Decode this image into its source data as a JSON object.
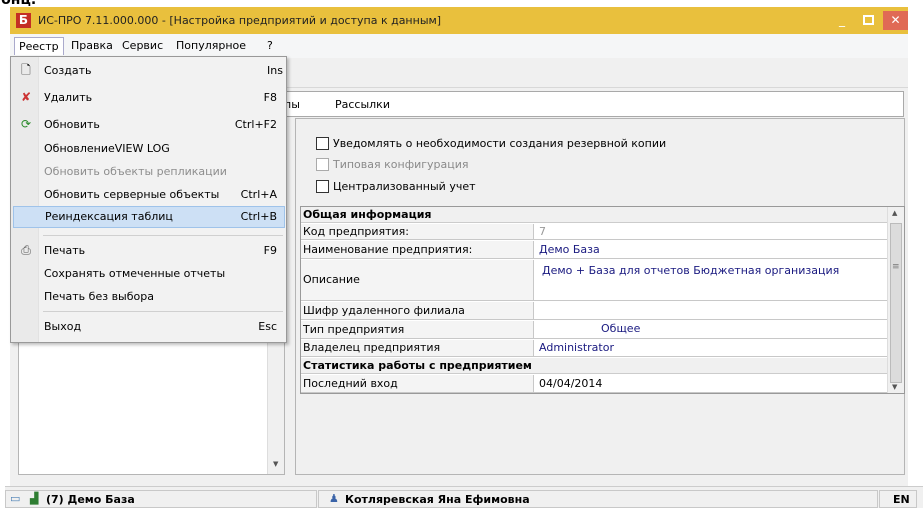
{
  "top_clipped_text": "бнц.",
  "window": {
    "title": "ИС-ПРО 7.11.000.000 - [Настройка предприятий и доступа к данным]",
    "logo_glyph": "Б",
    "title_color": "#e9c03d",
    "close_glyph": "✕",
    "minimize_glyph": "_"
  },
  "menubar": {
    "items": [
      "Реестр",
      "Правка",
      "Сервис",
      "Популярное",
      "?"
    ]
  },
  "tabs": {
    "partial": "пы",
    "label": "Рассылки"
  },
  "dropdown": {
    "items": [
      {
        "label": "Создать",
        "shortcut": "Ins",
        "icon": "new-document-icon",
        "disabled": false
      },
      {
        "label": "Удалить",
        "shortcut": "F8",
        "icon": "delete-document-icon",
        "disabled": false
      },
      {
        "label": "Обновить",
        "shortcut": "Ctrl+F2",
        "icon": "refresh-icon",
        "disabled": false
      },
      {
        "label": "ОбновлениеVIEW LOG",
        "shortcut": "",
        "icon": "",
        "disabled": false
      },
      {
        "label": "Обновить объекты репликации",
        "shortcut": "",
        "icon": "",
        "disabled": true
      },
      {
        "label": "Обновить серверные объекты",
        "shortcut": "Ctrl+A",
        "icon": "",
        "disabled": false
      },
      {
        "label": "Реиндексация таблиц",
        "shortcut": "Ctrl+B",
        "icon": "",
        "disabled": false,
        "highlighted": true
      },
      {
        "label": "Печать",
        "shortcut": "F9",
        "icon": "printer-icon",
        "disabled": false
      },
      {
        "label": "Сохранять отмеченные отчеты",
        "shortcut": "",
        "icon": "",
        "disabled": false
      },
      {
        "label": "Печать без выбора",
        "shortcut": "",
        "icon": "",
        "disabled": false
      },
      {
        "label": "Выход",
        "shortcut": "Esc",
        "icon": "",
        "disabled": false
      }
    ]
  },
  "options": {
    "notify_backup": "Уведомлять о необходимости создания резервной копии",
    "typical_config": "Типовая конфигурация",
    "centralized": "Централизованный учет"
  },
  "grid": {
    "section_general": "Общая информация",
    "rows_general": [
      {
        "label": "Код предприятия:",
        "value": "7"
      },
      {
        "label": "Наименование предприятия:",
        "value": "Демо База"
      },
      {
        "label": "Описание",
        "value": "Демо + База для отчетов  Бюджетная организация"
      },
      {
        "label": "Шифр удаленного филиала",
        "value": ""
      },
      {
        "label": "Тип предприятия",
        "value": "Общее"
      },
      {
        "label": "Владелец предприятия",
        "value": "Administrator"
      }
    ],
    "section_stats": "Статистика работы с предприятием",
    "rows_stats": [
      {
        "label": "Последний вход",
        "value": "04/04/2014"
      }
    ]
  },
  "statusbar": {
    "company": "(7) Демо База",
    "user": "Котляревская Яна Ефимовна",
    "lang": "EN"
  }
}
